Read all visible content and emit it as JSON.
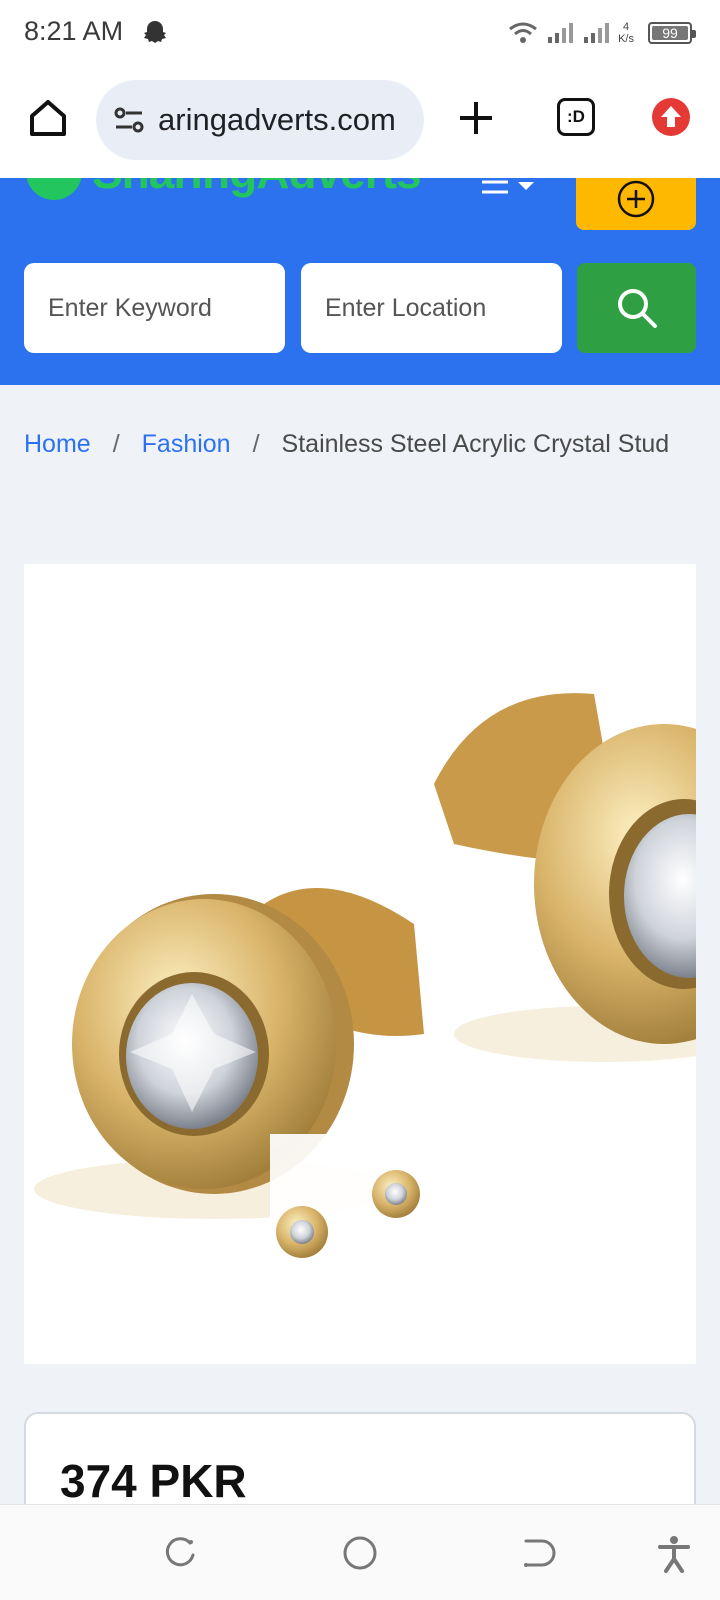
{
  "status_bar": {
    "time": "8:21 AM",
    "network_speed_value": "4",
    "network_speed_unit": "K/s",
    "battery": "99",
    "left_icon": "snapchat-ghost-icon"
  },
  "browser": {
    "url": "aringadverts.com",
    "tabs_label": ":D",
    "icons": {
      "home": "home-icon",
      "site_settings": "site-settings-icon",
      "new_tab": "plus-icon",
      "tabs": "tab-switcher-icon",
      "update": "update-arrow-icon"
    }
  },
  "site": {
    "logo_text": "SharingAdverts",
    "brand_color": "#2c72ee",
    "accent_green": "#22c55e",
    "post_button_color": "#ffb800",
    "search": {
      "keyword_placeholder": "Enter Keyword",
      "location_placeholder": "Enter Location",
      "button_icon": "search-icon"
    }
  },
  "breadcrumb": {
    "items": [
      "Home",
      "Fashion"
    ],
    "separator": "/",
    "current": "Stainless Steel Acrylic Crystal Stud"
  },
  "product": {
    "image": "gold-roman-numeral-crystal-stud-earrings",
    "price": "374 PKR"
  },
  "nav_bar": {
    "icons": [
      "recent-apps-icon",
      "home-circle-icon",
      "back-icon",
      "accessibility-icon"
    ]
  }
}
